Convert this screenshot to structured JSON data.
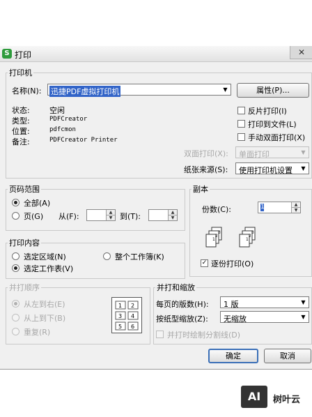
{
  "window": {
    "title": "打印",
    "close_glyph": "✕",
    "app_icon_letter": "S"
  },
  "printer": {
    "legend": "打印机",
    "name_label": "名称(N):",
    "name_value": "迅捷PDF虚拟打印机",
    "properties_button": "属性(P)...",
    "status_label": "状态:",
    "status_value": "空闲",
    "type_label": "类型:",
    "type_value": "PDFCreator",
    "location_label": "位置:",
    "location_value": "pdfcmon",
    "comment_label": "备注:",
    "comment_value": "PDFCreator Printer",
    "reverse_print": {
      "label": "反片打印(I)",
      "checked": false
    },
    "print_to_file": {
      "label": "打印到文件(L)",
      "checked": false
    },
    "manual_duplex": {
      "label": "手动双面打印(X)",
      "checked": false
    },
    "duplex_label": "双面打印(X):",
    "duplex_value": "单面打印",
    "paper_source_label": "纸张来源(S):",
    "paper_source_value": "使用打印机设置"
  },
  "page_range": {
    "legend": "页码范围",
    "all_label": "全部(A)",
    "pages_label": "页(G)",
    "from_label": "从(F):",
    "to_label": "到(T):",
    "selected": "all"
  },
  "copies": {
    "legend": "副本",
    "count_label": "份数(C):",
    "count_value": "1",
    "collate_label": "逐份打印(O)",
    "collate_checked": true,
    "stack1": [
      "1",
      "2",
      "3"
    ],
    "stack2": [
      "1",
      "2",
      "3"
    ]
  },
  "print_content": {
    "legend": "打印内容",
    "selection_label": "选定区域(N)",
    "workbook_label": "整个工作簿(K)",
    "sheet_label": "选定工作表(V)",
    "selected": "sheet"
  },
  "print_order": {
    "legend": "并打顺序",
    "left_to_right": "从左到右(E)",
    "top_to_bottom": "从上到下(B)",
    "repeat": "重复(R)",
    "grid": [
      "1",
      "2",
      "3",
      "4",
      "5",
      "6"
    ]
  },
  "merge_scale": {
    "legend": "并打和缩放",
    "pages_per_sheet_label": "每页的版数(H):",
    "pages_per_sheet_value": "1 版",
    "scale_label": "按纸型缩放(Z):",
    "scale_value": "无缩放",
    "draw_lines_label": "并打时绘制分割线(D)",
    "draw_lines_checked": false
  },
  "buttons": {
    "ok": "确定",
    "cancel": "取消"
  },
  "watermark": {
    "logo": "AI",
    "text": "树叶云"
  },
  "icons": {
    "arrow": "▼",
    "spin_up": "▲",
    "spin_down": "▼",
    "check": "✓"
  }
}
